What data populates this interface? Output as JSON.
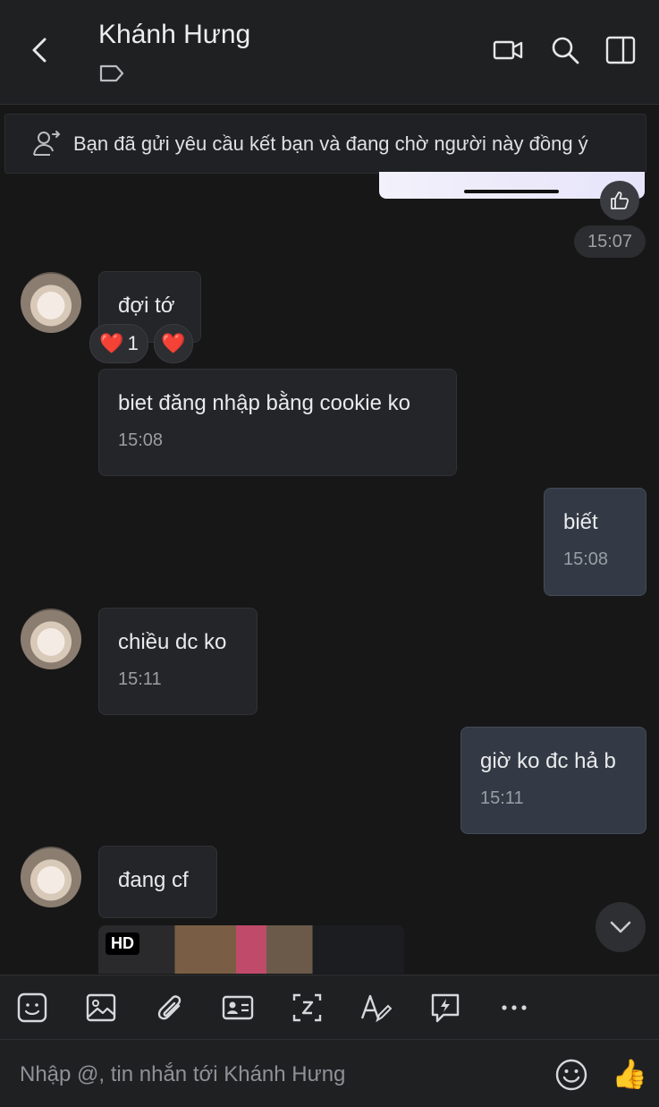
{
  "header": {
    "contact_name": "Khánh Hưng"
  },
  "banner": {
    "text": "Bạn đã gửi yêu cầu kết bạn và đang chờ người này đồng ý"
  },
  "previous": {
    "time": "15:07"
  },
  "messages": [
    {
      "text": "đợi tớ"
    },
    {
      "text": "biet đăng nhập bằng cookie ko",
      "time": "15:08"
    },
    {
      "text": "biết",
      "time": "15:08"
    },
    {
      "text": "chiều dc ko",
      "time": "15:11"
    },
    {
      "text": "giờ ko đc hả b",
      "time": "15:11"
    },
    {
      "text": "đang cf"
    }
  ],
  "reactions": {
    "count": "1"
  },
  "media": {
    "badge": "HD"
  },
  "composer": {
    "placeholder": "Nhập @, tin nhắn tới Khánh Hưng"
  },
  "colors": {
    "bg": "#171718",
    "incoming_bubble": "#242528",
    "outgoing_bubble": "#333a45"
  }
}
